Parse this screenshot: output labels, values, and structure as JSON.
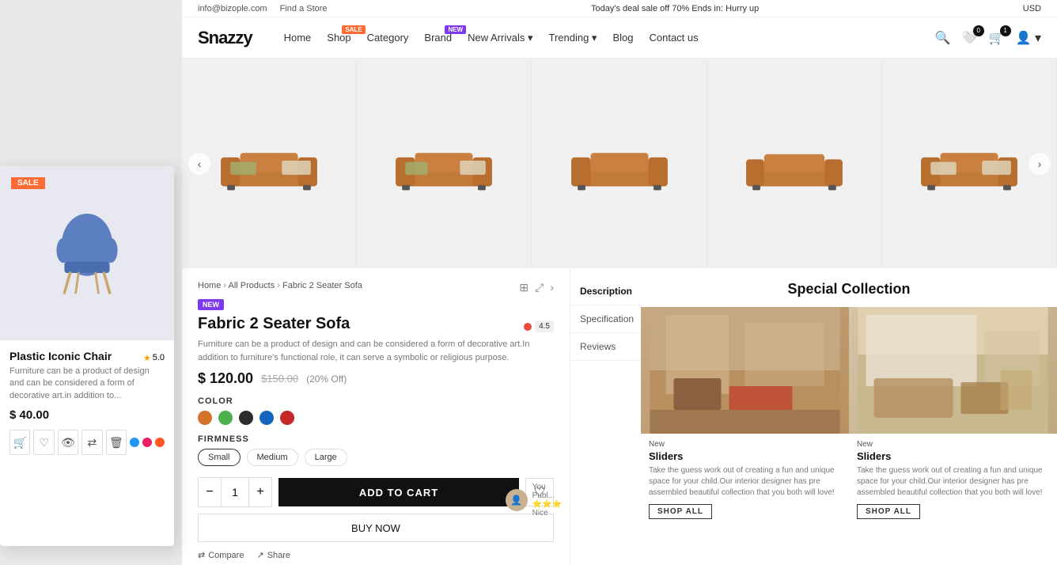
{
  "topbar": {
    "email": "info@bizople.com",
    "find_store": "Find a Store",
    "deal": "Today's deal sale off 70% Ends in: Hurry up",
    "currency": "USD"
  },
  "header": {
    "logo": "Snazzy",
    "nav": [
      {
        "label": "Home",
        "badge": null
      },
      {
        "label": "Shop",
        "badge": "SALE"
      },
      {
        "label": "Category",
        "badge": null
      },
      {
        "label": "Brand",
        "badge": "NEW"
      },
      {
        "label": "New Arrivals",
        "badge": null,
        "dropdown": true
      },
      {
        "label": "Trending",
        "badge": null,
        "dropdown": true
      },
      {
        "label": "Blog",
        "badge": null
      },
      {
        "label": "Contact us",
        "badge": null
      }
    ],
    "cart_count": "0",
    "wishlist_count": "1"
  },
  "breadcrumb": {
    "home": "Home",
    "all_products": "All Products",
    "current": "Fabric 2 Seater Sofa"
  },
  "product": {
    "badge": "NEW",
    "title": "Fabric 2 Seater Sofa",
    "description": "Furniture can be a product of design and can be considered a form of decorative art.In addition to furniture's functional role, it can serve a symbolic or religious purpose.",
    "price_current": "$ 120.00",
    "price_original": "$150.00",
    "price_off": "(20% Off)",
    "rating": "4.5",
    "color_label": "COLOR",
    "firmness_label": "FIRMNESS",
    "firmness_options": [
      "Small",
      "Medium",
      "Large"
    ],
    "qty": "1",
    "add_to_cart": "ADD TO CART",
    "buy_now": "BUY NOW",
    "compare": "Compare",
    "share": "Share"
  },
  "tabs": [
    {
      "label": "Description",
      "active": true
    },
    {
      "label": "Specification",
      "active": false
    },
    {
      "label": "Reviews",
      "active": false
    }
  ],
  "colors": [
    {
      "name": "orange",
      "hex": "#d4722a"
    },
    {
      "name": "green",
      "hex": "#4caf50"
    },
    {
      "name": "dark",
      "hex": "#2c2c2c"
    },
    {
      "name": "blue",
      "hex": "#1565c0"
    },
    {
      "name": "red",
      "hex": "#c62828"
    }
  ],
  "special_collection": {
    "title": "Special Collection",
    "items": [
      {
        "badge": "New",
        "name": "Sliders",
        "description": "Take the guess work out of creating a fun and unique space for your child.Our interior designer has pre assembled beautiful collection that you both will love!",
        "shop_all": "SHOP ALL"
      },
      {
        "badge": "New",
        "name": "Sliders",
        "description": "Take the guess work out of creating a fun and unique space for your child.Our interior designer has pre assembled beautiful collection that you both will love!",
        "shop_all": "SHOP ALL"
      }
    ]
  },
  "left_card": {
    "badge": "SALE",
    "title": "Plastic Iconic Chair",
    "rating": "5.0",
    "description": "Furniture can be a product of design and can be considered a form of decorative art.in addition to...",
    "price": "$ 40.00",
    "colors": [
      "#2196f3",
      "#e91e63",
      "#ff5722"
    ]
  }
}
